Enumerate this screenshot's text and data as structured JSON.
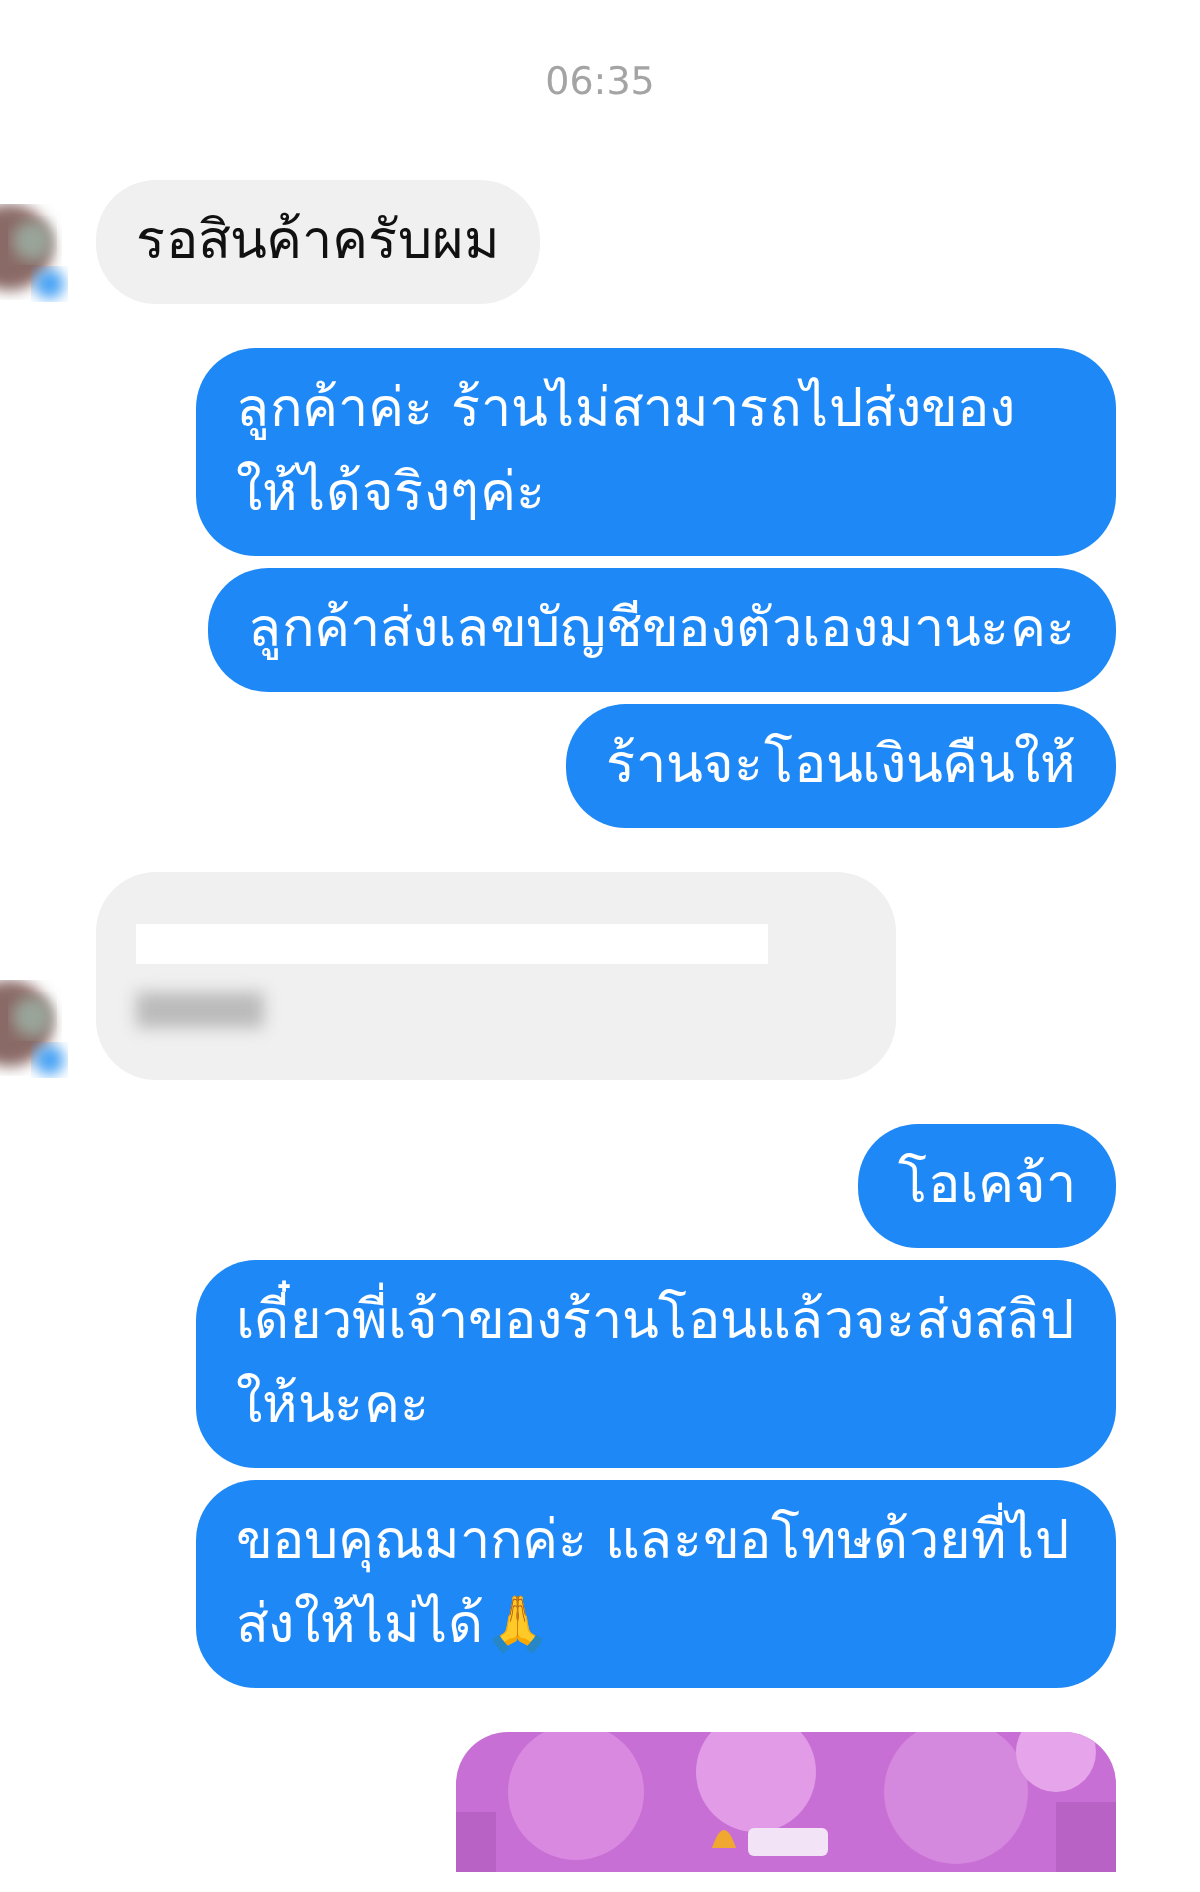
{
  "timestamp": "06:35",
  "messages": [
    {
      "kind": "text",
      "outgoing": false,
      "avatar": true,
      "text": "รอสินค้าครับผม"
    },
    {
      "kind": "text",
      "outgoing": true,
      "text": "ลูกค้าค่ะ ร้านไม่สามารถไปส่งของให้ได้จริงๆค่ะ"
    },
    {
      "kind": "text",
      "outgoing": true,
      "text": "ลูกค้าส่งเลขบัญชีของตัวเองมานะคะ"
    },
    {
      "kind": "text",
      "outgoing": true,
      "text": "ร้านจะโอนเงินคืนให้"
    },
    {
      "kind": "redacted",
      "outgoing": false,
      "avatar": true
    },
    {
      "kind": "text",
      "outgoing": true,
      "text": "โอเคจ้า"
    },
    {
      "kind": "text",
      "outgoing": true,
      "text": "เดี๋ยวพี่เจ้าของร้านโอนแล้วจะส่งสลิปให้นะคะ"
    },
    {
      "kind": "text",
      "outgoing": true,
      "text": "ขอบคุณมากค่ะ และขอโทษด้วยที่ไปส่งให้ไม่ได้🙏"
    },
    {
      "kind": "picture",
      "outgoing": true
    }
  ]
}
